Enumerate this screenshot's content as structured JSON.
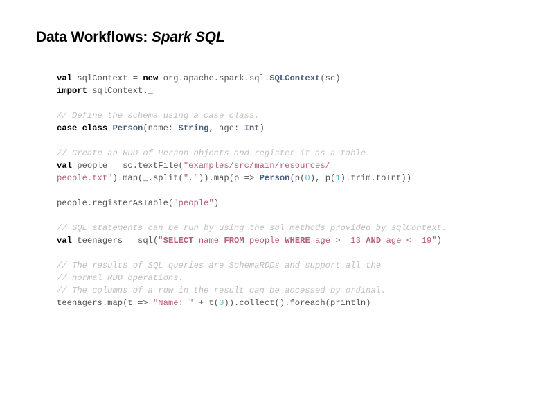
{
  "slide": {
    "title_main": "Data Workflows:",
    "title_emphasis": "Spark SQL",
    "background_color": "#ffffff"
  },
  "colors": {
    "plain": "#555555",
    "keyword": "#000000",
    "type": "#4a5f80",
    "string": "#b5607c",
    "sql_keyword": "#b5607c",
    "comment": "#bfbfbf",
    "number": "#5bbcd4"
  },
  "code": {
    "language": "scala",
    "lines": [
      {
        "id": "line-1",
        "tokens": [
          {
            "t": "val",
            "k": "keyword"
          },
          {
            "t": " sqlContext = ",
            "k": "plain"
          },
          {
            "t": "new",
            "k": "keyword"
          },
          {
            "t": " org.apache.spark.sql.",
            "k": "plain"
          },
          {
            "t": "SQLContext",
            "k": "type"
          },
          {
            "t": "(sc)",
            "k": "plain"
          }
        ]
      },
      {
        "id": "line-2",
        "tokens": [
          {
            "t": "import",
            "k": "keyword"
          },
          {
            "t": " sqlContext._",
            "k": "plain"
          }
        ]
      },
      {
        "id": "line-3",
        "blank": true,
        "tokens": []
      },
      {
        "id": "line-4",
        "tokens": [
          {
            "t": "// Define the schema using a case class.",
            "k": "comment"
          }
        ]
      },
      {
        "id": "line-5",
        "tokens": [
          {
            "t": "case class ",
            "k": "keyword"
          },
          {
            "t": "Person",
            "k": "type"
          },
          {
            "t": "(name: ",
            "k": "plain"
          },
          {
            "t": "String",
            "k": "type"
          },
          {
            "t": ", age: ",
            "k": "plain"
          },
          {
            "t": "Int",
            "k": "type"
          },
          {
            "t": ")",
            "k": "plain"
          }
        ]
      },
      {
        "id": "line-6",
        "blank": true,
        "tokens": []
      },
      {
        "id": "line-7",
        "tokens": [
          {
            "t": "// Create an RDD of Person objects and register it as a table.",
            "k": "comment"
          }
        ]
      },
      {
        "id": "line-8",
        "tokens": [
          {
            "t": "val",
            "k": "keyword"
          },
          {
            "t": " people = sc.textFile(",
            "k": "plain"
          },
          {
            "t": "\"examples/src/main/resources/",
            "k": "string"
          }
        ]
      },
      {
        "id": "line-9",
        "tokens": [
          {
            "t": "people.txt\"",
            "k": "string"
          },
          {
            "t": ").map(_.split(",
            "k": "plain"
          },
          {
            "t": "\",\"",
            "k": "string"
          },
          {
            "t": ")).map(p => ",
            "k": "plain"
          },
          {
            "t": "Person",
            "k": "type"
          },
          {
            "t": "(p(",
            "k": "plain"
          },
          {
            "t": "0",
            "k": "number"
          },
          {
            "t": "), p(",
            "k": "plain"
          },
          {
            "t": "1",
            "k": "number"
          },
          {
            "t": ").trim.toInt))",
            "k": "plain"
          }
        ]
      },
      {
        "id": "line-10",
        "blank": true,
        "tokens": []
      },
      {
        "id": "line-11",
        "tokens": [
          {
            "t": "people.registerAsTable(",
            "k": "plain"
          },
          {
            "t": "\"people\"",
            "k": "string"
          },
          {
            "t": ")",
            "k": "plain"
          }
        ]
      },
      {
        "id": "line-12",
        "blank": true,
        "tokens": []
      },
      {
        "id": "line-13",
        "tokens": [
          {
            "t": "// SQL statements can be run by using the sql methods provided by sqlContext.",
            "k": "comment"
          }
        ]
      },
      {
        "id": "line-14",
        "tokens": [
          {
            "t": "val",
            "k": "keyword"
          },
          {
            "t": " teenagers = sql(",
            "k": "plain"
          },
          {
            "t": "\"",
            "k": "string"
          },
          {
            "t": "SELECT",
            "k": "sql_keyword"
          },
          {
            "t": " name ",
            "k": "string"
          },
          {
            "t": "FROM",
            "k": "sql_keyword"
          },
          {
            "t": " people ",
            "k": "string"
          },
          {
            "t": "WHERE",
            "k": "sql_keyword"
          },
          {
            "t": " age >= 13 ",
            "k": "string"
          },
          {
            "t": "AND",
            "k": "sql_keyword"
          },
          {
            "t": " age <= 19\"",
            "k": "string"
          },
          {
            "t": ")",
            "k": "plain"
          }
        ]
      },
      {
        "id": "line-15",
        "blank": true,
        "tokens": []
      },
      {
        "id": "line-16",
        "tokens": [
          {
            "t": "// The results of SQL queries are SchemaRDDs and support all the",
            "k": "comment"
          }
        ]
      },
      {
        "id": "line-17",
        "tokens": [
          {
            "t": "// normal RDD operations.",
            "k": "comment"
          }
        ]
      },
      {
        "id": "line-18",
        "tokens": [
          {
            "t": "// The columns of a row in the result can be accessed by ordinal.",
            "k": "comment"
          }
        ]
      },
      {
        "id": "line-19",
        "tokens": [
          {
            "t": "teenagers.map(t => ",
            "k": "plain"
          },
          {
            "t": "\"Name: \"",
            "k": "string"
          },
          {
            "t": " + t(",
            "k": "plain"
          },
          {
            "t": "0",
            "k": "number"
          },
          {
            "t": ")).collect().foreach(println)",
            "k": "plain"
          }
        ]
      }
    ]
  }
}
